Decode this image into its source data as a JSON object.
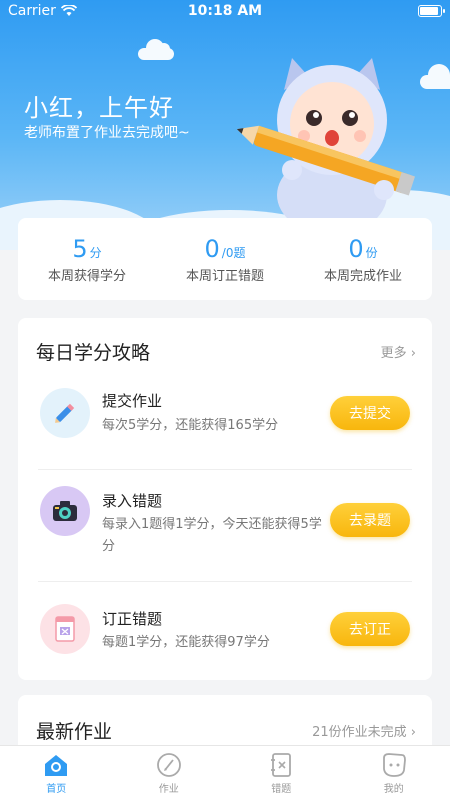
{
  "status": {
    "carrier": "Carrier",
    "time": "10:18 AM"
  },
  "hero": {
    "greeting": "小红，上午好",
    "subtitle": "老师布置了作业去完成吧~"
  },
  "stats": [
    {
      "value": "5",
      "unit": "分",
      "label": "本周获得学分"
    },
    {
      "value": "0",
      "unit": "/0题",
      "label": "本周订正错题"
    },
    {
      "value": "0",
      "unit": "份",
      "label": "本周完成作业"
    }
  ],
  "daily": {
    "title": "每日学分攻略",
    "more": "更多",
    "tasks": [
      {
        "name": "提交作业",
        "desc": "每次5学分，还能获得165学分",
        "button": "去提交",
        "icon": "pencil-icon"
      },
      {
        "name": "录入错题",
        "desc": "每录入1题得1学分，今天还能获得5学分",
        "button": "去录题",
        "icon": "camera-icon"
      },
      {
        "name": "订正错题",
        "desc": "每题1学分，还能获得97学分",
        "button": "去订正",
        "icon": "notebook-icon"
      }
    ]
  },
  "homework": {
    "title": "最新作业",
    "more": "21份作业未完成"
  },
  "tabs": [
    {
      "label": "首页",
      "icon": "home-icon",
      "active": true
    },
    {
      "label": "作业",
      "icon": "homework-icon",
      "active": false
    },
    {
      "label": "错题",
      "icon": "mistakes-icon",
      "active": false
    },
    {
      "label": "我的",
      "icon": "profile-icon",
      "active": false
    }
  ],
  "colors": {
    "primary": "#2f9bf2",
    "accent": "#f8b60d"
  }
}
